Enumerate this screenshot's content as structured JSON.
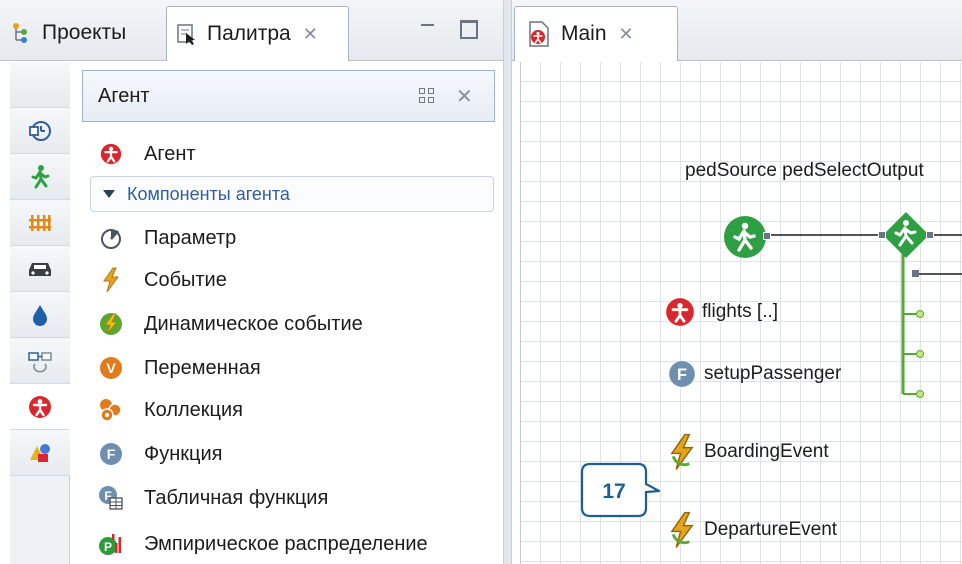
{
  "left_panel": {
    "tabs": [
      {
        "label": "Проекты",
        "icon": "projects-icon"
      },
      {
        "label": "Палитра",
        "icon": "palette-icon",
        "active": true
      }
    ],
    "palette": {
      "header": "Агент",
      "top_item": {
        "label": "Агент",
        "icon": "agent-icon"
      },
      "section": "Компоненты агента",
      "items": [
        {
          "label": "Параметр",
          "icon": "parameter-icon"
        },
        {
          "label": "Событие",
          "icon": "event-icon"
        },
        {
          "label": "Динамическое событие",
          "icon": "dynamic-event-icon"
        },
        {
          "label": "Переменная",
          "icon": "variable-icon"
        },
        {
          "label": "Коллекция",
          "icon": "collection-icon"
        },
        {
          "label": "Функция",
          "icon": "function-icon"
        },
        {
          "label": "Табличная функция",
          "icon": "table-function-icon"
        },
        {
          "label": "Эмпирическое распределение",
          "icon": "empirical-distribution-icon"
        }
      ]
    },
    "vertical_tabs": [
      "blank-tab",
      "process-modeling-icon",
      "pedestrian-icon",
      "rail-icon",
      "road-traffic-icon",
      "fluid-icon",
      "system-dynamics-icon",
      "agent-icon",
      "presentation-icon"
    ]
  },
  "editor": {
    "tab": {
      "label": "Main",
      "icon": "agent-type-icon"
    },
    "canvas_label": "pedSource pedSelectOutput",
    "elements": [
      {
        "label": "flights [..]",
        "icon": "agent-population-icon"
      },
      {
        "label": "setupPassenger",
        "icon": "function-icon"
      },
      {
        "label": "BoardingEvent",
        "icon": "event-icon"
      },
      {
        "label": "DepartureEvent",
        "icon": "event-icon"
      }
    ]
  },
  "callout": {
    "number": "17"
  },
  "colors": {
    "accent_blue": "#2f5f9d",
    "agent_red": "#d9272e",
    "ped_green": "#2ea043",
    "flow_green": "#5aa832",
    "callout_blue": "#1f5d95"
  }
}
